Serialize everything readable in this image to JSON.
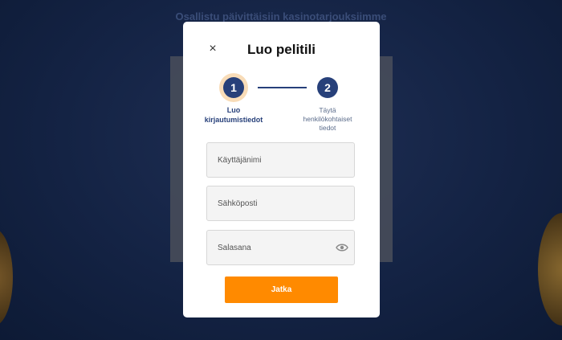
{
  "background": {
    "heading": "Osallistu päivittäisiin kasinotarjouksiimme"
  },
  "modal": {
    "close_icon": "×",
    "title": "Luo pelitili",
    "steps": [
      {
        "number": "1",
        "label": "Luo kirjautumistiedot"
      },
      {
        "number": "2",
        "label": "Täytä henkilökohtaiset tiedot"
      }
    ],
    "fields": {
      "username_placeholder": "Käyttäjänimi",
      "email_placeholder": "Sähköposti",
      "password_placeholder": "Salasana"
    },
    "password_toggle_icon": "eye-icon",
    "submit_label": "Jatka"
  },
  "colors": {
    "accent": "#ff8a00",
    "primary": "#27407a",
    "step_highlight": "#f8dcb8"
  }
}
